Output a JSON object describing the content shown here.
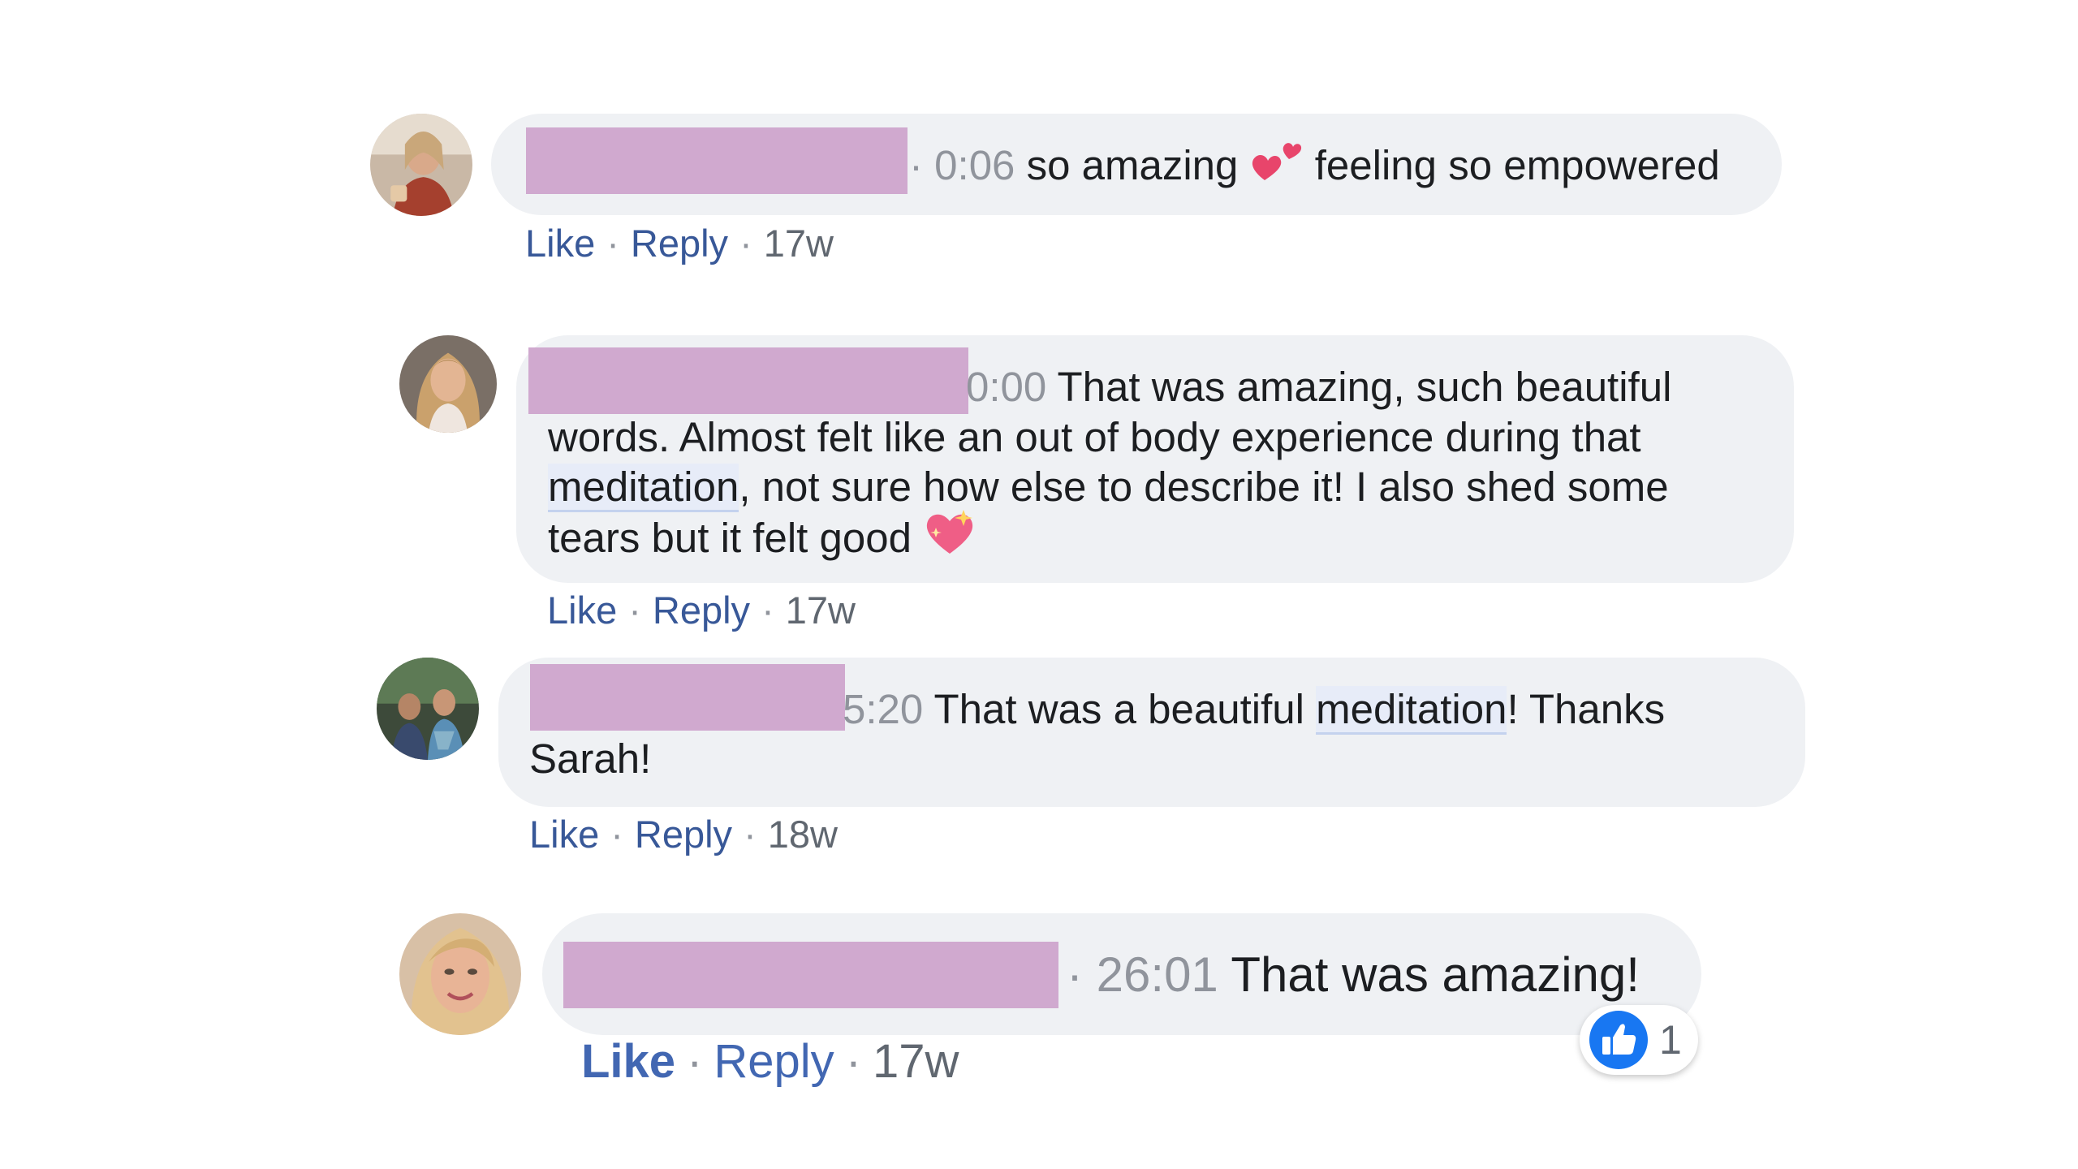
{
  "comments": [
    {
      "timestamp": "0:06",
      "separator": "·",
      "text_before_emoji": " so amazing ",
      "emoji": "two-hearts-emoji",
      "text_after_emoji": " feeling so empowered",
      "actions": {
        "like": "Like",
        "reply": "Reply",
        "age": "17w"
      }
    },
    {
      "timestamp": "0:00",
      "line1": " That was amazing, such beautiful",
      "line2": "words. Almost felt like an out of body experience during that",
      "highlight": "meditation",
      "line3_rest": ", not sure how else to describe it! I also shed some",
      "line4": "tears but it felt good ",
      "emoji": "sparkling-heart-emoji",
      "actions": {
        "like": "Like",
        "reply": "Reply",
        "age": "17w"
      }
    },
    {
      "timestamp": "5:20",
      "text_before": " That was a beautiful ",
      "highlight": "meditation",
      "text_after": "! Thanks",
      "line2": "Sarah!",
      "actions": {
        "like": "Like",
        "reply": "Reply",
        "age": "18w"
      }
    },
    {
      "timestamp": "26:01",
      "separator": "·",
      "text": " That was amazing!",
      "reaction": {
        "icon": "thumbs-up-icon",
        "count": "1"
      },
      "actions": {
        "like": "Like",
        "reply": "Reply",
        "age": "17w"
      }
    }
  ],
  "colors": {
    "bubble": "#eff1f4",
    "redaction": "#d0a9cf",
    "link": "#385898",
    "like_blue": "#4267b2",
    "timestamp": "#90949c"
  }
}
